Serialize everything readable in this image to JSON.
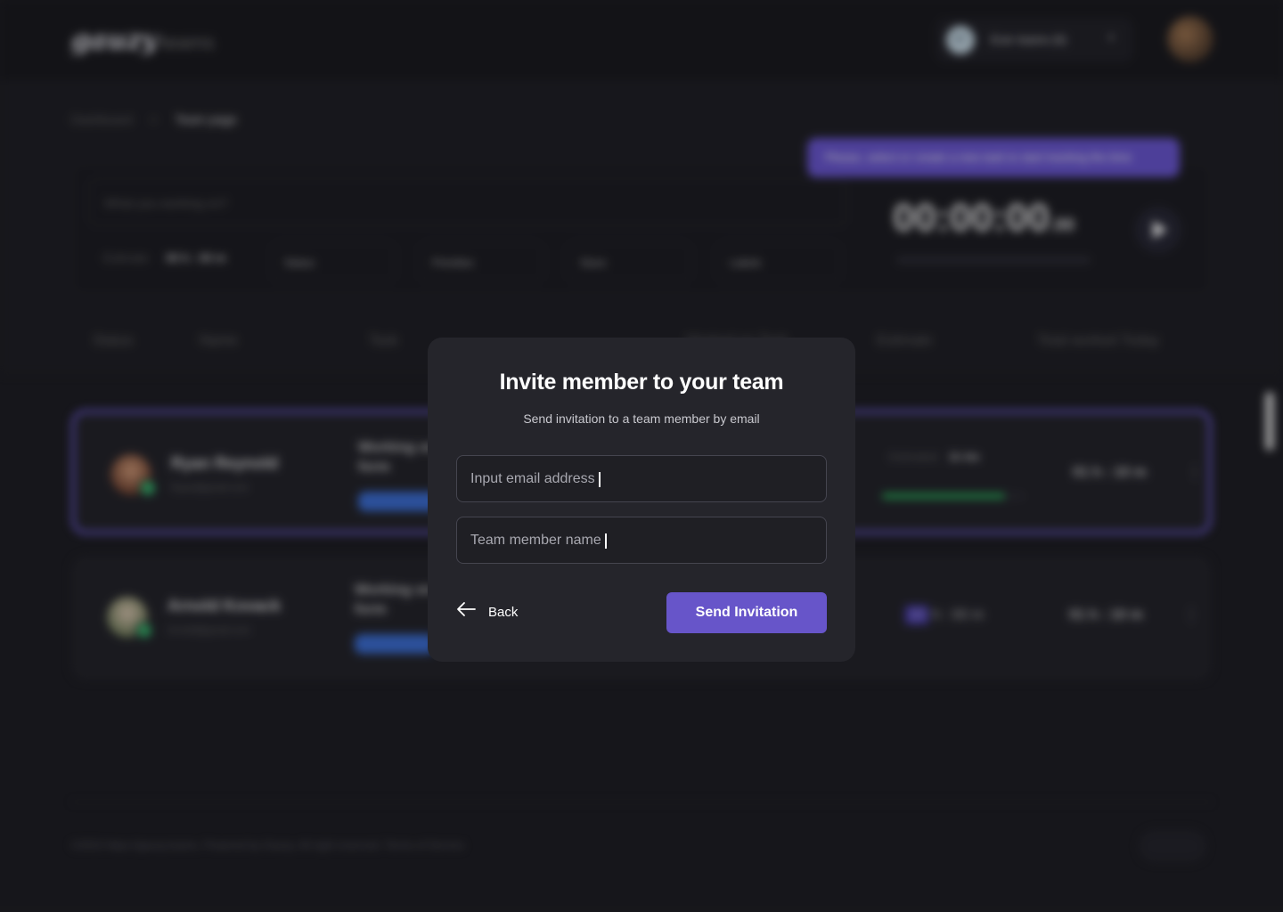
{
  "app": {
    "logo_main": "gauzy",
    "logo_sub": "teams",
    "team_selector": {
      "initials": "ET",
      "label": "Ever teams (6)"
    },
    "breadcrumb": {
      "parent": "Dashboard",
      "separator": ">",
      "current": "Team page"
    }
  },
  "timer": {
    "tooltip": "Please, select or create a new task to start tracking the time",
    "task_placeholder": "What you working on?",
    "estimate_label": "Estimate",
    "estimate_value": "00 h : 00 m",
    "filters": [
      "Status",
      "Priorities",
      "Sizes",
      "Labels"
    ],
    "time": "00:00:00",
    "time_ms": ".00"
  },
  "table": {
    "headers": [
      "Status",
      "Name",
      "Task",
      "Worked on Task",
      "Estimate",
      "Total worked Today"
    ]
  },
  "members": [
    {
      "name": "Ryan Reynold",
      "email": "Ryan@gmail.com",
      "task": "Working on testing form",
      "estimate_label": "Estimated:",
      "estimate_value": "1h 4m",
      "estimate_progress": 0.86,
      "total_today": "01 h : 10 m"
    },
    {
      "name": "Arnold Kovack",
      "email": "Arnold@gmail.com",
      "task": "Working on testing form",
      "estimate_hours": "10",
      "estimate_rest": "h : 00 m",
      "total_today": "01 h : 10 m"
    }
  ],
  "footer": {
    "text": "©2022 https://gauzy.teams. Powered by Gauzy. All right reserved. Terms of Service"
  },
  "modal": {
    "title": "Invite member to your team",
    "subtitle": "Send invitation to a team member by email",
    "email_placeholder": "Input email address",
    "name_placeholder": "Team member name",
    "back_label": "Back",
    "send_label": "Send Invitation"
  }
}
